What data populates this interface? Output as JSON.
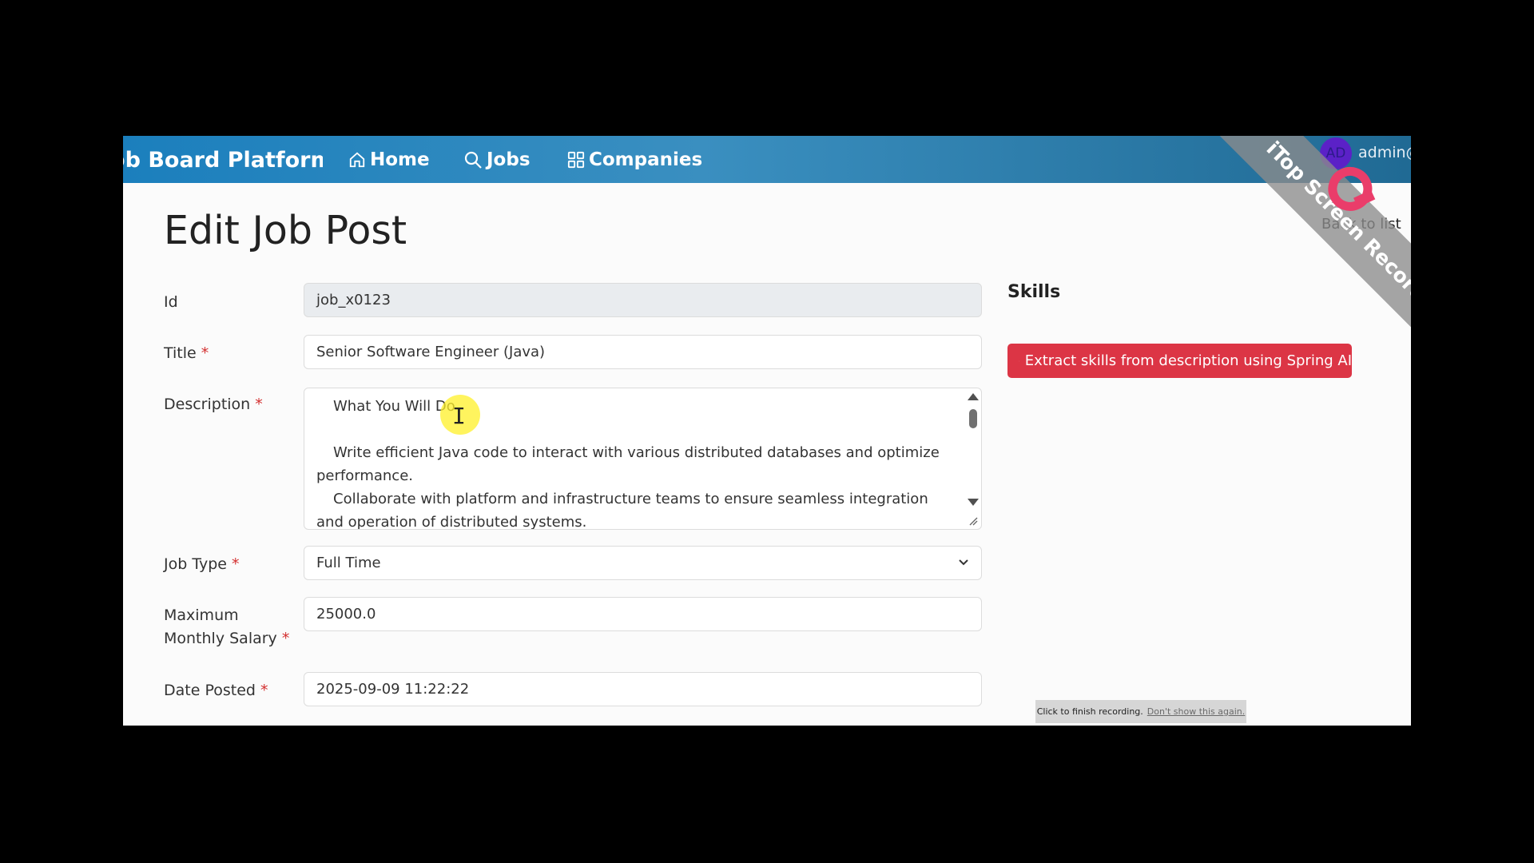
{
  "navbar": {
    "brand": "Job Board Platform",
    "links": [
      {
        "label": "Home",
        "icon": "house-icon"
      },
      {
        "label": "Jobs",
        "icon": "search-icon"
      },
      {
        "label": "Companies",
        "icon": "grid-icon"
      }
    ],
    "avatar_initials": "AD",
    "user": "admin@"
  },
  "page": {
    "title": "Edit Job Post",
    "back_link": "Back to list"
  },
  "form": {
    "id_label": "Id",
    "id_value": "job_x0123",
    "title_label": "Title",
    "title_value": "Senior Software Engineer (Java)",
    "description_label": "Description",
    "description_lines": [
      "What You Will Do",
      "Write efficient Java code to interact with various distributed databases and optimize performance.",
      "Collaborate with platform and infrastructure teams to ensure seamless integration and operation of distributed systems."
    ],
    "job_type_label": "Job Type",
    "job_type_value": "Full Time",
    "salary_label_line1": "Maximum",
    "salary_label_line2": "Monthly Salary",
    "salary_value": "25000.0",
    "date_label": "Date Posted",
    "date_value": "2025-09-09 11:22:22",
    "required_marker": "*"
  },
  "skills": {
    "title": "Skills",
    "extract_button": "Extract skills from description using Spring AI"
  },
  "overlay": {
    "watermark": "iTop Screen Recorder",
    "recording_prompt": "Click to finish recording.",
    "dont_show": "Don't show this again."
  },
  "colors": {
    "navbar": "#1b7fbd",
    "danger": "#dc3545",
    "required": "#d32f2f"
  }
}
